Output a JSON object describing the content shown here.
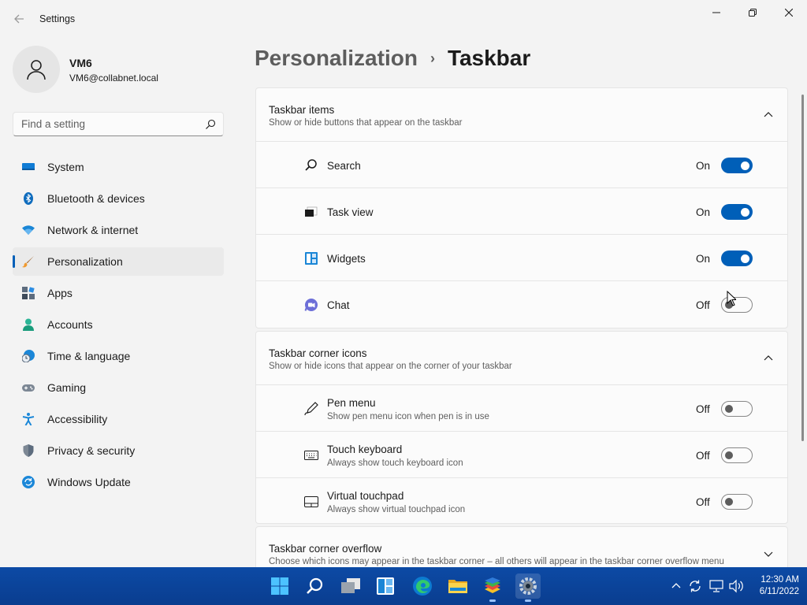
{
  "window": {
    "title": "Settings"
  },
  "profile": {
    "name": "VM6",
    "email": "VM6@collabnet.local"
  },
  "search": {
    "placeholder": "Find a setting"
  },
  "nav": [
    {
      "label": "System",
      "icon": "monitor-icon"
    },
    {
      "label": "Bluetooth & devices",
      "icon": "bluetooth-icon"
    },
    {
      "label": "Network & internet",
      "icon": "wifi-icon"
    },
    {
      "label": "Personalization",
      "icon": "brush-icon",
      "active": true
    },
    {
      "label": "Apps",
      "icon": "apps-icon"
    },
    {
      "label": "Accounts",
      "icon": "person-icon"
    },
    {
      "label": "Time & language",
      "icon": "clock-globe-icon"
    },
    {
      "label": "Gaming",
      "icon": "gamepad-icon"
    },
    {
      "label": "Accessibility",
      "icon": "accessibility-icon"
    },
    {
      "label": "Privacy & security",
      "icon": "shield-icon"
    },
    {
      "label": "Windows Update",
      "icon": "update-icon"
    }
  ],
  "breadcrumb": {
    "parent": "Personalization",
    "separator": "›",
    "current": "Taskbar"
  },
  "taskbar_items": {
    "title": "Taskbar items",
    "description": "Show or hide buttons that appear on the taskbar",
    "rows": [
      {
        "label": "Search",
        "state": "On",
        "on": true,
        "icon": "search-icon"
      },
      {
        "label": "Task view",
        "state": "On",
        "on": true,
        "icon": "task-view-icon"
      },
      {
        "label": "Widgets",
        "state": "On",
        "on": true,
        "icon": "widgets-icon"
      },
      {
        "label": "Chat",
        "state": "Off",
        "on": false,
        "icon": "chat-icon"
      }
    ]
  },
  "corner_icons": {
    "title": "Taskbar corner icons",
    "description": "Show or hide icons that appear on the corner of your taskbar",
    "rows": [
      {
        "label": "Pen menu",
        "sub": "Show pen menu icon when pen is in use",
        "state": "Off",
        "on": false,
        "icon": "pen-icon"
      },
      {
        "label": "Touch keyboard",
        "sub": "Always show touch keyboard icon",
        "state": "Off",
        "on": false,
        "icon": "keyboard-icon"
      },
      {
        "label": "Virtual touchpad",
        "sub": "Always show virtual touchpad icon",
        "state": "Off",
        "on": false,
        "icon": "touchpad-icon"
      }
    ]
  },
  "corner_overflow": {
    "title": "Taskbar corner overflow",
    "description": "Choose which icons may appear in the taskbar corner – all others will appear in the taskbar corner overflow menu"
  },
  "clock": {
    "time": "12:30 AM",
    "date": "6/11/2022"
  },
  "colors": {
    "accent": "#005fb8",
    "taskbar": "#0c4aa5"
  }
}
